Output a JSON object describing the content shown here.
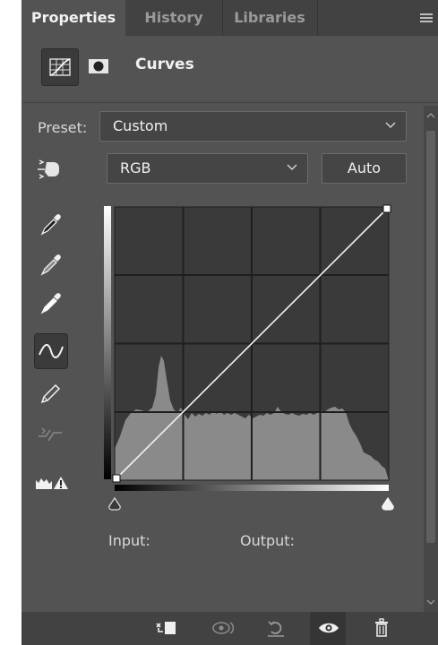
{
  "tabs": [
    {
      "label": "Properties",
      "active": true
    },
    {
      "label": "History",
      "active": false
    },
    {
      "label": "Libraries",
      "active": false
    }
  ],
  "header": {
    "title": "Curves",
    "icons": [
      "curves-adjustment-icon",
      "layer-mask-icon"
    ]
  },
  "preset": {
    "label": "Preset:",
    "value": "Custom"
  },
  "channel": {
    "value": "RGB",
    "auto_label": "Auto"
  },
  "tools": [
    "on-image-adjustment-icon",
    "black-point-eyedropper-icon",
    "gray-point-eyedropper-icon",
    "white-point-eyedropper-icon",
    "edit-points-curve-icon",
    "draw-pencil-icon",
    "smooth-curve-icon",
    "clipping-warning-icon"
  ],
  "curve": {
    "input_label": "Input:",
    "output_label": "Output:",
    "points": [
      [
        0,
        0
      ],
      [
        255,
        255
      ]
    ]
  },
  "bottom_bar": [
    "clip-to-layer-icon",
    "view-previous-state-icon",
    "reset-defaults-icon",
    "toggle-visibility-icon",
    "delete-adjustment-icon"
  ],
  "colors": {
    "panel_bg": "#535353",
    "tab_bar": "#424242",
    "graph_bg": "#3a3a3a",
    "histogram": "#8a8a8a"
  }
}
